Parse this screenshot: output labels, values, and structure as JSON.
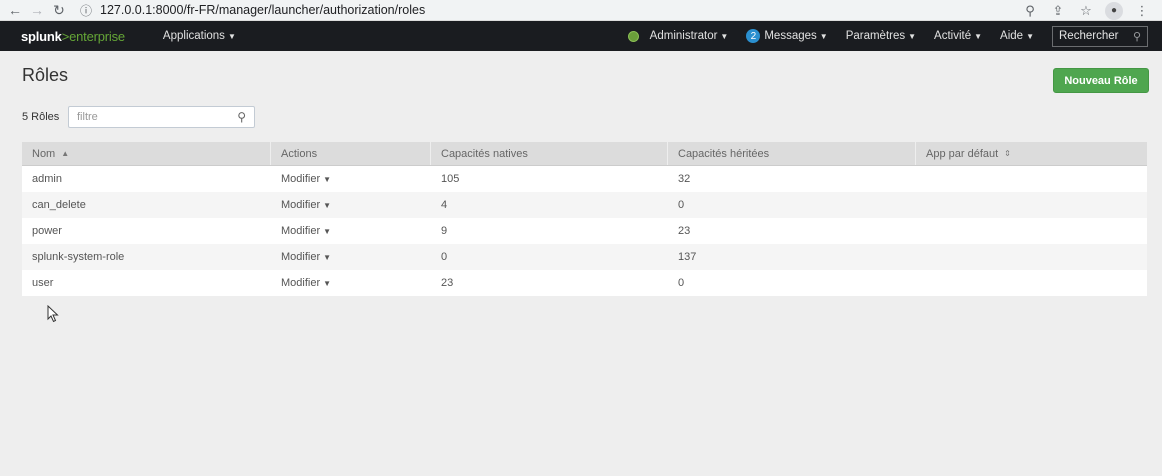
{
  "browser": {
    "url": "127.0.0.1:8000/fr-FR/manager/launcher/authorization/roles",
    "icons": [
      "back-icon",
      "forward-icon",
      "reload-icon",
      "info-icon",
      "zoom-icon",
      "share-icon",
      "star-icon",
      "profile-icon",
      "more-icon"
    ]
  },
  "topnav": {
    "logo": {
      "part1": "splunk",
      "part2": ">",
      "part3": "enterprise"
    },
    "apps_label": "Applications",
    "user_label": "Administrator",
    "messages_count": "2",
    "messages_label": "Messages",
    "settings_label": "Paramètres",
    "activity_label": "Activité",
    "help_label": "Aide",
    "search_placeholder": "Rechercher"
  },
  "page": {
    "title": "Rôles",
    "new_role_label": "Nouveau Rôle",
    "count_label": "5 Rôles",
    "filter_placeholder": "filtre"
  },
  "table": {
    "columns": [
      "Nom",
      "Actions",
      "Capacités natives",
      "Capacités héritées",
      "App par défaut"
    ],
    "rows": [
      {
        "name": "admin",
        "action": "Modifier",
        "native": "105",
        "inherited": "32",
        "default_app": ""
      },
      {
        "name": "can_delete",
        "action": "Modifier",
        "native": "4",
        "inherited": "0",
        "default_app": ""
      },
      {
        "name": "power",
        "action": "Modifier",
        "native": "9",
        "inherited": "23",
        "default_app": ""
      },
      {
        "name": "splunk-system-role",
        "action": "Modifier",
        "native": "0",
        "inherited": "137",
        "default_app": ""
      },
      {
        "name": "user",
        "action": "Modifier",
        "native": "23",
        "inherited": "0",
        "default_app": ""
      }
    ]
  },
  "colors": {
    "topnav_bg": "#1a1c20",
    "brand_green": "#65a637",
    "button_green": "#4fa64f",
    "badge_blue": "#2a8fcf"
  }
}
